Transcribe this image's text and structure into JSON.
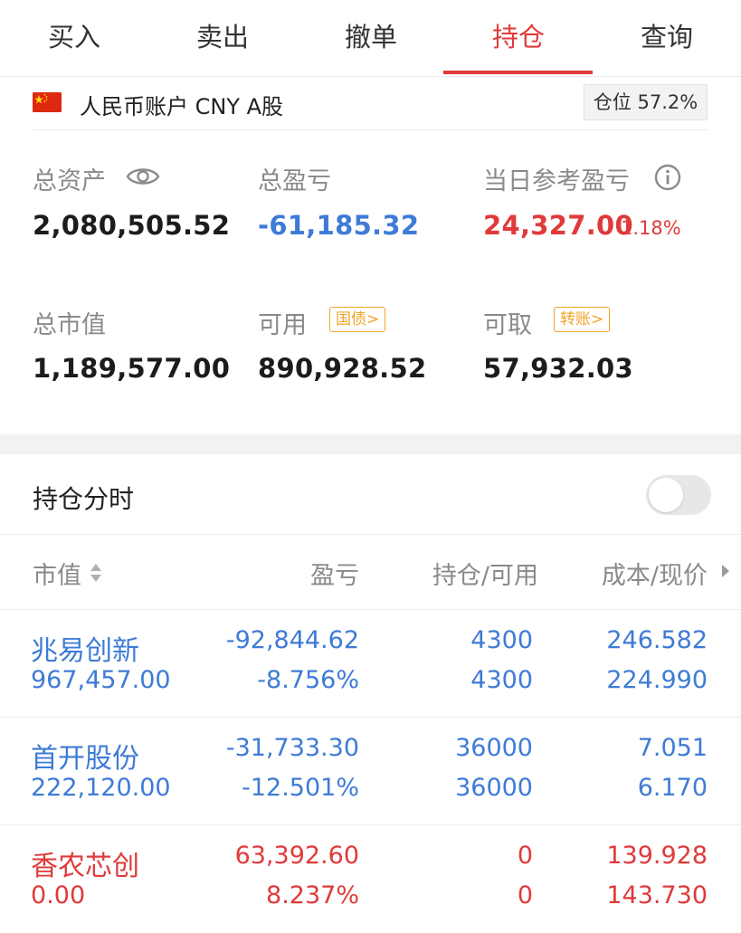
{
  "tabs": [
    {
      "label": "买入"
    },
    {
      "label": "卖出"
    },
    {
      "label": "撤单"
    },
    {
      "label": "持仓",
      "active": true
    },
    {
      "label": "查询"
    }
  ],
  "account": {
    "name": "人民币账户 CNY A股",
    "position_label": "仓位",
    "position_value": "57.2%"
  },
  "stats": {
    "total_assets_label": "总资产",
    "total_assets_value": "2,080,505.52",
    "total_pl_label": "总盈亏",
    "total_pl_value": "-61,185.32",
    "day_pl_label": "当日参考盈亏",
    "day_pl_value": "24,327.00",
    "day_pl_pct": "1.18%",
    "market_value_label": "总市值",
    "market_value_value": "1,189,577.00",
    "available_label": "可用",
    "available_tag": "国债>",
    "available_value": "890,928.52",
    "withdrawable_label": "可取",
    "withdrawable_tag": "转账>",
    "withdrawable_value": "57,932.03"
  },
  "holding_time": {
    "label": "持仓分时",
    "enabled": false
  },
  "table": {
    "headers": [
      "市值",
      "盈亏",
      "持仓/可用",
      "成本/现价"
    ],
    "rows": [
      {
        "name": "兆易创新",
        "market_value": "967,457.00",
        "pl": "-92,844.62",
        "pl_pct": "-8.756%",
        "holding": "4300",
        "available": "4300",
        "cost": "246.582",
        "price": "224.990",
        "color": "#3e7bd6"
      },
      {
        "name": "首开股份",
        "market_value": "222,120.00",
        "pl": "-31,733.30",
        "pl_pct": "-12.501%",
        "holding": "36000",
        "available": "36000",
        "cost": "7.051",
        "price": "6.170",
        "color": "#3e7bd6"
      },
      {
        "name": "香农芯创",
        "market_value": "0.00",
        "pl": "63,392.60",
        "pl_pct": "8.237%",
        "holding": "0",
        "available": "0",
        "cost": "139.928",
        "price": "143.730",
        "color": "#e03a3a"
      }
    ]
  },
  "colors": {
    "accent": "#e03a3a",
    "loss": "#3e7bd6",
    "tag": "#f0a428"
  }
}
